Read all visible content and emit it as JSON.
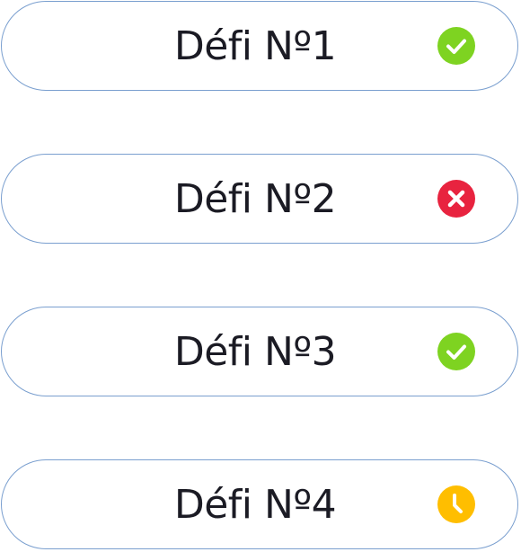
{
  "challenges": [
    {
      "label": "Défi Nº1",
      "status": "done",
      "icon": "check-circle-icon",
      "color": "#7ed321"
    },
    {
      "label": "Défi Nº2",
      "status": "failed",
      "icon": "cross-circle-icon",
      "color": "#e8233f"
    },
    {
      "label": "Défi Nº3",
      "status": "done",
      "icon": "check-circle-icon",
      "color": "#7ed321"
    },
    {
      "label": "Défi Nº4",
      "status": "pending",
      "icon": "clock-circle-icon",
      "color": "#ffbe00"
    }
  ]
}
